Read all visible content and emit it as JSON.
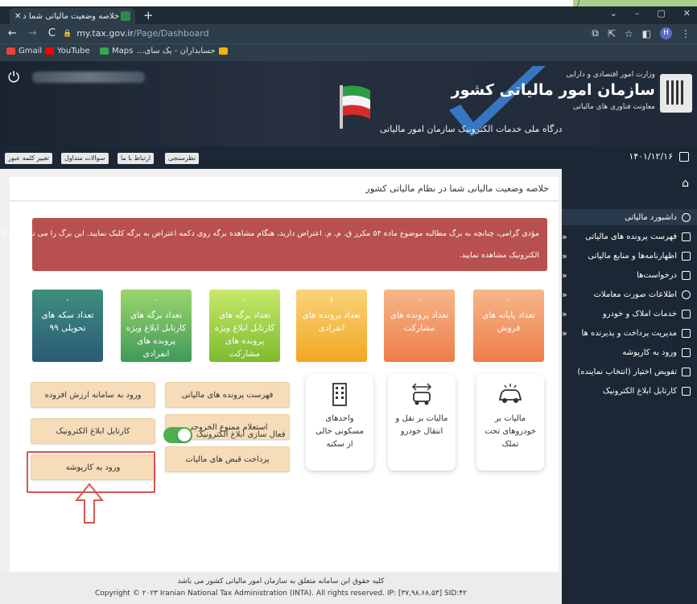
{
  "browser": {
    "tab_title": "خلاصه وضعیت مالیاتی شما در نظا...",
    "new_tab": "+",
    "window_controls": [
      "⌄",
      "–",
      "▢",
      "✕"
    ],
    "url_host": "my.tax.gov.ir",
    "url_path": "/Page/Dashboard",
    "profile_initial": "H",
    "bookmarks": [
      {
        "label": "Gmail",
        "color": "#ea4335"
      },
      {
        "label": "YouTube",
        "color": "#ff0000"
      },
      {
        "label": "Maps",
        "color": "#34a853"
      },
      {
        "label": "حسابداران - یک سای...",
        "color": "#f4b400"
      }
    ]
  },
  "header": {
    "ministry": "وزارت امور اقتصادی و دارایی",
    "org_name": "سازمان امور مالیاتی کشور",
    "deputy": "معاونت فناوری های مالیاتی",
    "portal_title": "درگاه ملی خدمات الکترونیک سازمان امور مالیاتی"
  },
  "navbar": {
    "date": "۱۴۰۱/۱۲/۱۶",
    "buttons": [
      "تغییر کلمه عبور",
      "سوالات متداول",
      "ارتباط با ما",
      "نظرسنجی"
    ]
  },
  "page_title": "خلاصه وضعیت مالیاتی شما در نظام مالیاتی کشور",
  "alert": {
    "line1": "مؤدی گرامی، چنانچه به برگ مطالبه موضوع ماده ۵۴ مکرر ق. م. م. اعتراض دارید، هنگام مشاهده برگه روی دکمه اعتراض به برگه کلیک نمایید. این برگ را می توانید در کارتابل ابلاغ",
    "line2": "الکترونیک مشاهده نمایید.",
    "color": "#b7504f"
  },
  "tiles": [
    {
      "value": "۰",
      "label": "تعداد پایانه های فروش"
    },
    {
      "value": "۰",
      "label": "تعداد پرونده های مشارکت"
    },
    {
      "value": "۱",
      "label": "تعداد پرونده های انفرادی"
    },
    {
      "value": "۰",
      "label": "تعداد برگه های کارتابل ابلاغ ویژه پرونده های مشارکت"
    },
    {
      "value": "۰",
      "label": "تعداد برگه های کارتابل ابلاغ ویژه پرونده های انفرادی"
    },
    {
      "value": "۰",
      "label": "تعداد سکه های تحویلی ۹۹"
    }
  ],
  "services": [
    {
      "label": "مالیات بر خودروهای تحت تملک",
      "icon": "car-icon"
    },
    {
      "label": "مالیات بر نقل و انتقال خودرو",
      "icon": "car-transfer-icon"
    },
    {
      "label": "واحدهای مسکونی خالی از سکنه",
      "icon": "building-icon"
    }
  ],
  "buttons": {
    "tax_files": "فهرست پرونده های مالیاتی",
    "exit_ban": "استعلام ممنوع الخروجی",
    "pay_bills": "پرداخت قبض های مالیات",
    "vat_system": "ورود به سامانه ارزش افزوده",
    "e_notice": "کارتابل ابلاغ الکترونیک",
    "karpooshe": "ورود به کارپوشه"
  },
  "toggle": {
    "label": "فعال سازی ابلاغ الکترونیک",
    "on": true
  },
  "sidebar": {
    "items": [
      {
        "label": "داشبورد مالیاتی",
        "chevron": false
      },
      {
        "label": "فهرست پرونده های مالیاتی",
        "chevron": true
      },
      {
        "label": "اظهارنامه‌ها و منابع مالیاتی",
        "chevron": true
      },
      {
        "label": "درخواست‌ها",
        "chevron": true
      },
      {
        "label": "اطلاعات صورت معاملات",
        "chevron": true
      },
      {
        "label": "خدمات املاک و خودرو",
        "chevron": true
      },
      {
        "label": "مدیریت پرداخت و پذیرنده ها",
        "chevron": true
      },
      {
        "label": "ورود به کارپوشه",
        "chevron": false
      },
      {
        "label": "تفویض اختیار (انتخاب نماینده)",
        "chevron": false
      },
      {
        "label": "کارتابل ابلاغ الکترونیک",
        "chevron": false
      }
    ],
    "chevron_glyph": "«"
  },
  "footer": {
    "line1": "کلیه حقوق این سامانه متعلق به سازمان امور مالیاتی کشور می باشد",
    "line2": "Copyright © ۲۰۲۳ Iranian National Tax Administration (INTA). All rights reserved. IP: [۳۷,۹۸.۶۸.۵۳] SID:۴۲"
  }
}
